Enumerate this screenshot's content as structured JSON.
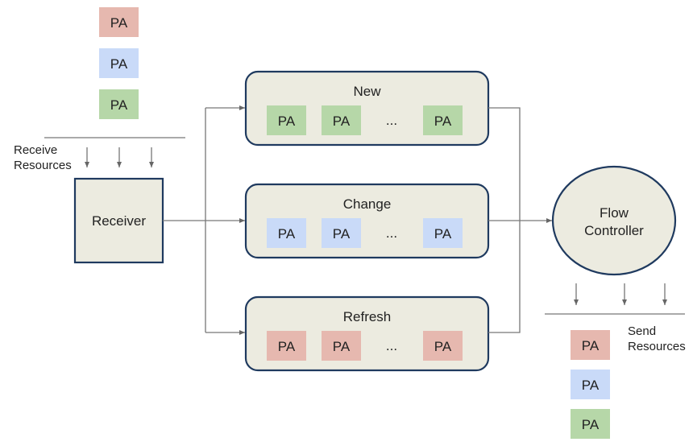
{
  "colors": {
    "red": "#e6b8af",
    "blue": "#c9daf8",
    "green": "#b6d7a8",
    "node_fill": "#ecebe0",
    "node_stroke": "#1f3a5f"
  },
  "pa_label": "PA",
  "ellipsis": "...",
  "input": {
    "label_line1": "Receive",
    "label_line2": "Resources",
    "packets": [
      "red",
      "blue",
      "green"
    ]
  },
  "receiver": {
    "label": "Receiver"
  },
  "queues": [
    {
      "title": "New",
      "color": "green"
    },
    {
      "title": "Change",
      "color": "blue"
    },
    {
      "title": "Refresh",
      "color": "red"
    }
  ],
  "flow_controller": {
    "line1": "Flow",
    "line2": "Controller"
  },
  "output": {
    "label_line1": "Send",
    "label_line2": "Resources",
    "packets": [
      "red",
      "blue",
      "green"
    ]
  }
}
